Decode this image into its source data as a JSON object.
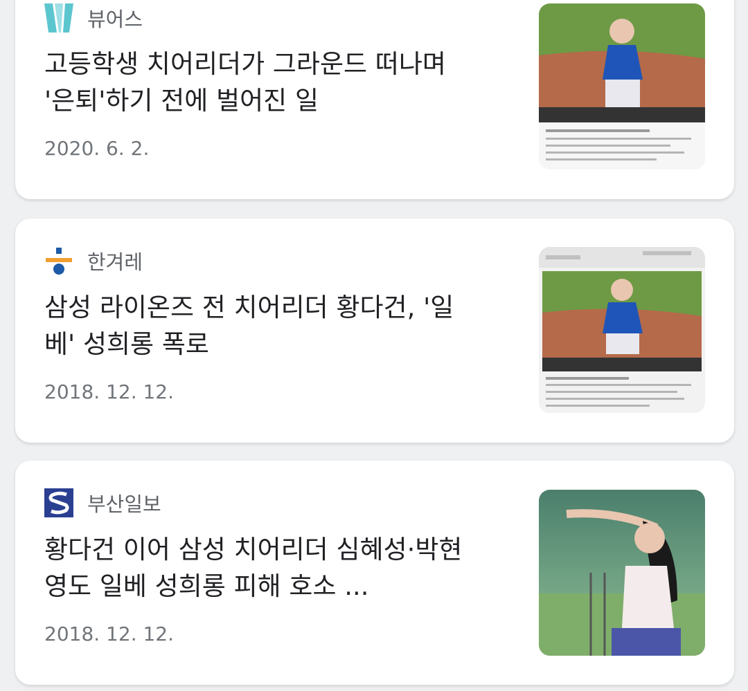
{
  "articles": [
    {
      "source": "뷰어스",
      "logo_icon": "viewers-logo-icon",
      "title_line1": "고등학생 치어리더가 그라운드 떠나며",
      "title_line2": "'은퇴'하기 전에 벌어진 일",
      "date": "2020. 6. 2.",
      "thumbnail": "cheerleader-screenshot-thumbnail"
    },
    {
      "source": "한겨레",
      "logo_icon": "hankyoreh-logo-icon",
      "title_line1": "삼성 라이온즈 전 치어리더 황다건, '일",
      "title_line2": "베' 성희롱 폭로",
      "date": "2018. 12. 12.",
      "thumbnail": "cheerleader-screenshot-thumbnail"
    },
    {
      "source": "부산일보",
      "logo_icon": "busan-ilbo-logo-icon",
      "title_line1": "황다건 이어 삼성 치어리더 심혜성·박현",
      "title_line2": "영도 일베 성희롱 피해 호소 ...",
      "date": "2018. 12. 12.",
      "thumbnail": "cheerleader-photo-thumbnail"
    }
  ],
  "colors": {
    "viewers_logo": "#5cc6cf",
    "hankyoreh_orange": "#f0a030",
    "hankyoreh_blue": "#1d5aa8",
    "busan_logo": "#2b3f91"
  }
}
